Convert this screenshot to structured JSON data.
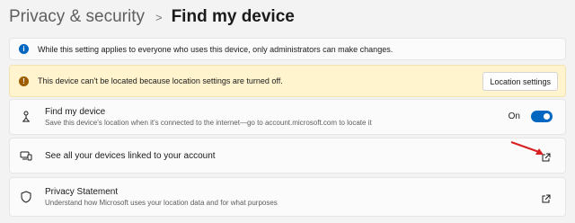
{
  "breadcrumb": {
    "parent": "Privacy & security",
    "separator": ">",
    "current": "Find my device"
  },
  "info_bar": {
    "icon": "info-icon",
    "text": "While this setting applies to everyone who uses this device, only administrators can make changes.",
    "accent": "#0067c0"
  },
  "warning_bar": {
    "icon": "warning-icon",
    "text": "This device can't be located because location settings are turned off.",
    "button_label": "Location settings",
    "background": "#fff4ce"
  },
  "find_my_device": {
    "icon": "location-person-icon",
    "title": "Find my device",
    "description": "Save this device's location when it's connected to the internet—go to account.microsoft.com to locate it",
    "toggle_label": "On",
    "toggle_on": true,
    "accent": "#0067c0"
  },
  "devices_link": {
    "icon": "devices-icon",
    "title": "See all your devices linked to your account",
    "action_icon": "external-link-icon"
  },
  "privacy_statement": {
    "icon": "shield-icon",
    "title": "Privacy Statement",
    "description": "Understand how Microsoft uses your location data and for what purposes",
    "action_icon": "external-link-icon"
  },
  "annotation": {
    "icon": "red-arrow-icon",
    "color": "#d92020"
  }
}
